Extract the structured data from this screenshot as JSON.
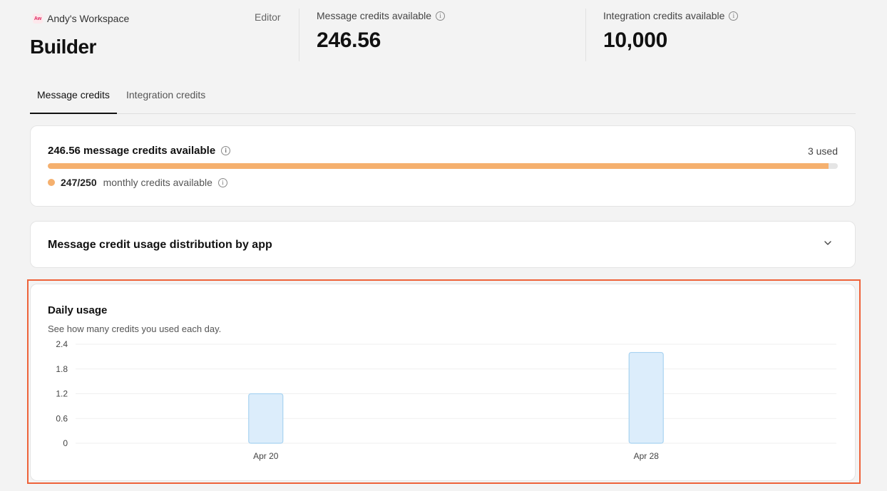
{
  "header": {
    "workspace_logo": "Aw",
    "workspace_name": "Andy's Workspace",
    "title": "Builder",
    "role": "Editor",
    "metrics": [
      {
        "label": "Message credits available",
        "value": "246.56"
      },
      {
        "label": "Integration credits available",
        "value": "10,000"
      }
    ]
  },
  "tabs": [
    {
      "label": "Message credits",
      "active": true
    },
    {
      "label": "Integration credits",
      "active": false
    }
  ],
  "credits_card": {
    "title": "246.56 message credits available",
    "used": "3 used",
    "progress_fraction": 0.988,
    "legend_count": "247/250",
    "legend_text": "monthly credits available",
    "color": "#f5b06e"
  },
  "distribution_card": {
    "title": "Message credit usage distribution by app",
    "icon": "chevron-down-icon"
  },
  "daily_usage": {
    "title": "Daily usage",
    "subtitle": "See how many credits you used each day."
  },
  "chart_data": {
    "type": "bar",
    "categories": [
      "Apr 20",
      "Apr 28"
    ],
    "values": [
      1.2,
      2.2
    ],
    "yticks": [
      "0",
      "0.6",
      "1.2",
      "1.8",
      "2.4"
    ],
    "ylim": [
      0,
      2.4
    ],
    "grid": true,
    "bar_fill": "#dcedfb",
    "bar_stroke": "#a9d3f1"
  },
  "highlight_color": "#ee6239"
}
